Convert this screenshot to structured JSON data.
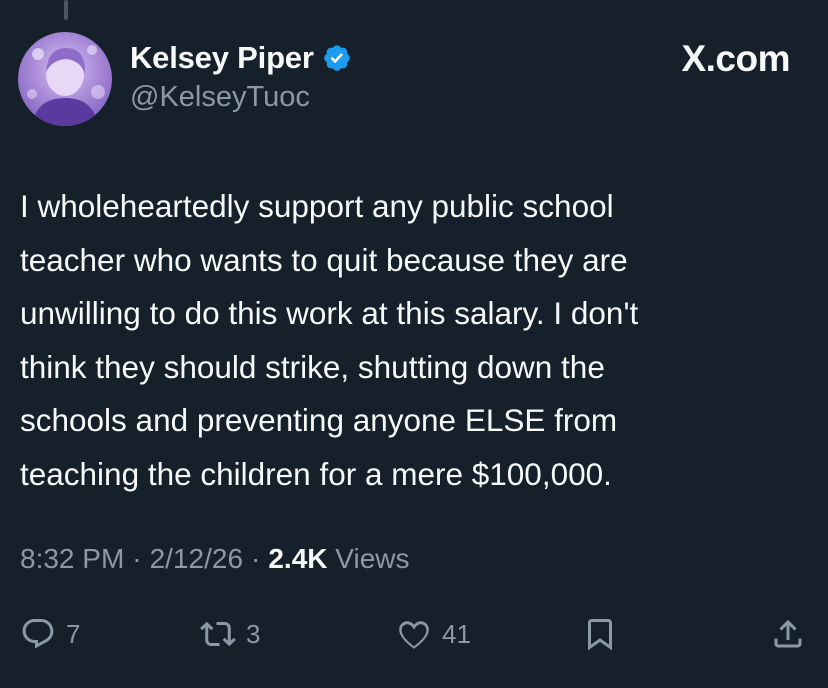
{
  "author": {
    "display_name": "Kelsey Piper",
    "handle": "@KelseyTuoc",
    "verified": true
  },
  "brand": "X.com",
  "tweet": {
    "text": "I wholeheartedly support any public school\nteacher who wants to quit because they are\nunwilling to do this work at this salary. I don't\nthink they should strike, shutting down the\nschools and preventing anyone ELSE from\nteaching the children for a mere $100,000.",
    "time": "8:32 PM",
    "date": "2/12/26",
    "separator": "·",
    "views_count": "2.4K",
    "views_label": "Views"
  },
  "actions": {
    "reply_count": "7",
    "retweet_count": "3",
    "like_count": "41"
  },
  "colors": {
    "background": "#15202b",
    "primary_text": "#f7f9f9",
    "secondary_text": "#8b98a5",
    "verified_badge": "#1d9bf0"
  }
}
